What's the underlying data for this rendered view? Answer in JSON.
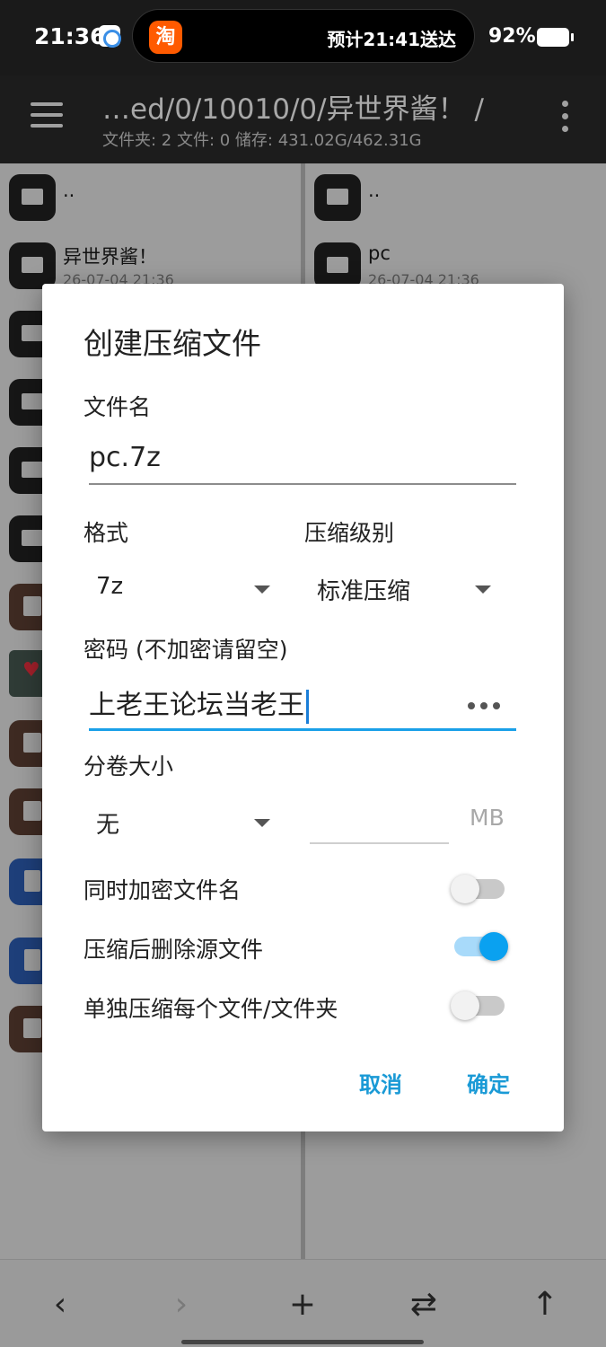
{
  "status_bar": {
    "time": "21:36",
    "island_logo": "淘",
    "island_text": "预计21:41送达",
    "battery": "92%"
  },
  "toolbar": {
    "path": "…ed/0/10010/0/异世界酱！ /",
    "info": "文件夹: 2  文件: 0  储存: 431.02G/462.31G"
  },
  "left_pane": {
    "items": [
      {
        "name": "..",
        "date": "",
        "type": "folder"
      },
      {
        "name": "异世界酱！",
        "date": "26-07-04 21:36",
        "type": "folder"
      },
      {
        "name": "",
        "date": "",
        "type": "folder"
      },
      {
        "name": "",
        "date": "",
        "type": "folder"
      },
      {
        "name": "",
        "date": "",
        "type": "folder"
      },
      {
        "name": "",
        "date": "",
        "type": "folder"
      },
      {
        "name": "",
        "date": "",
        "type": "archive"
      },
      {
        "name": "",
        "date": "",
        "type": "image"
      },
      {
        "name": "",
        "date": "",
        "type": "archive"
      },
      {
        "name": "",
        "date": "",
        "type": "archive"
      },
      {
        "name": "",
        "date": "",
        "type": "document"
      },
      {
        "name": "",
        "date": "",
        "type": "document"
      },
      {
        "name": "",
        "date": "",
        "type": "archive"
      }
    ]
  },
  "right_pane": {
    "items": [
      {
        "name": "..",
        "date": "",
        "type": "folder"
      },
      {
        "name": "pc",
        "date": "26-07-04 21:36",
        "type": "folder"
      }
    ]
  },
  "dialog": {
    "title": "创建压缩文件",
    "filename_label": "文件名",
    "filename_value": "pc.7z",
    "format_label": "格式",
    "format_value": "7z",
    "level_label": "压缩级别",
    "level_value": "标准压缩",
    "password_label": "密码 (不加密请留空)",
    "password_value": "上老王论坛当老王",
    "volume_label": "分卷大小",
    "volume_value": "无",
    "volume_unit": "MB",
    "toggles": [
      {
        "label": "同时加密文件名",
        "on": false
      },
      {
        "label": "压缩后删除源文件",
        "on": true
      },
      {
        "label": "单独压缩每个文件/文件夹",
        "on": false
      }
    ],
    "cancel_label": "取消",
    "confirm_label": "确定"
  },
  "bottom_bar": {
    "back_icon": "‹",
    "forward_icon": "›",
    "add_icon": "+",
    "swap_icon": "⇄",
    "up_icon": "↑"
  },
  "colors": {
    "accent": "#1a9ad6",
    "switch_on": "#0aa1f0",
    "toolbar_bg": "#1c1c1c"
  }
}
